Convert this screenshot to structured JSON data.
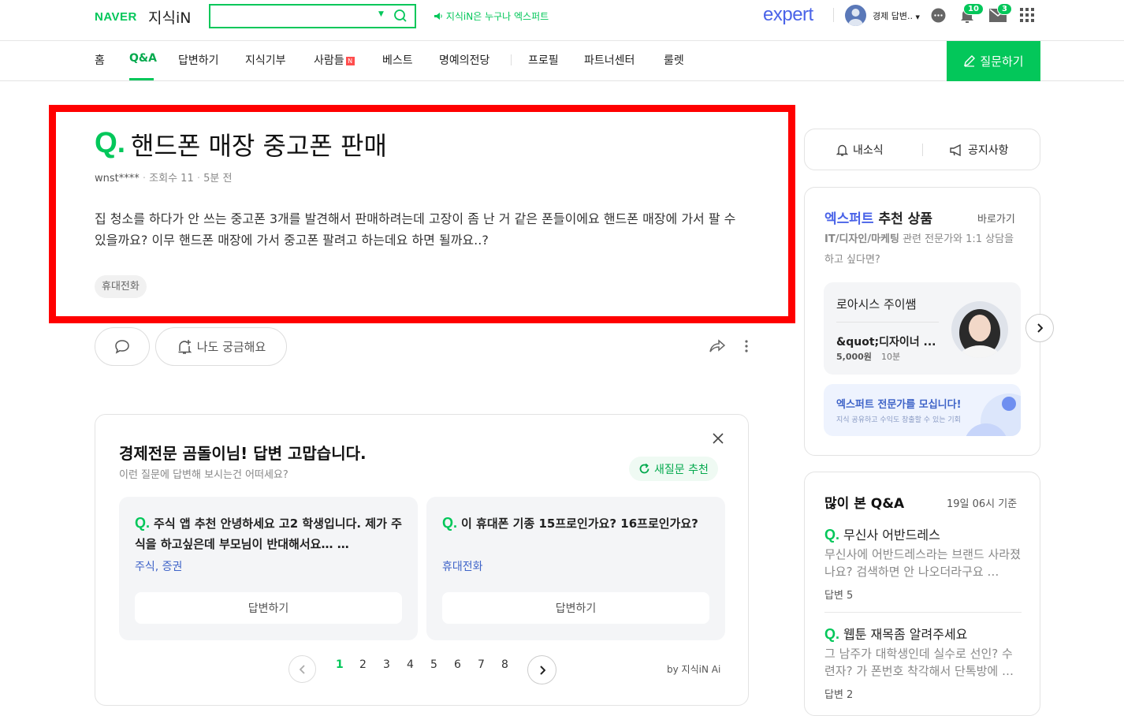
{
  "topbar": {
    "logo_naver": "NAVER",
    "logo_service": "지식iN",
    "search_placeholder": "",
    "slogan": "지식iN은 누구나 엑스퍼트",
    "expert_logo": "expert",
    "user_name": "경제 답변..",
    "notification_count": "10",
    "mail_count": "3"
  },
  "nav": {
    "items": [
      "홈",
      "Q&A",
      "답변하기",
      "지식기부",
      "사람들",
      "베스트",
      "명예의전당",
      "프로필",
      "파트너센터",
      "룰렛"
    ],
    "new_badge": "N",
    "ask_button": "질문하기"
  },
  "question": {
    "q_mark": "Q.",
    "title": "핸드폰 매장 중고폰 판매",
    "author": "wnst****",
    "views": "조회수 11",
    "time": "5분 전",
    "body": "집 청소를 하다가 안 쓰는 중고폰 3개를 발견해서 판매하려는데 고장이 좀 난 거 같은 폰들이에요 핸드폰 매장에 가서 팔 수 있을까요? 이무 핸드폰 매장에 가서 중고폰 팔려고 하는데요 하면 될까요..?",
    "tag": "휴대전화",
    "curious_button": "나도 궁금해요"
  },
  "recommend": {
    "title": "경제전문 곰돌이님! 답변 고맙습니다.",
    "subtitle": "이런 질문에 답변해 보시는건 어떠세요?",
    "refresh": "새질문 추천",
    "cards": [
      {
        "q": "Q.",
        "text": "주식 앱 추천 안녕하세요 고2 학생입니다. 제가 주식을 하고싶은데 부모님이 반대해서요… …",
        "category": "주식, 증권",
        "button": "답변하기"
      },
      {
        "q": "Q.",
        "text": "이 휴대폰 기종 15프로인가요? 16프로인가요?",
        "category": "휴대전화",
        "button": "답변하기"
      }
    ],
    "pages": [
      "1",
      "2",
      "3",
      "4",
      "5",
      "6",
      "7",
      "8"
    ],
    "by_label": "by 지식iN Ai"
  },
  "sidebar": {
    "my_news": "내소식",
    "notice": "공지사항",
    "expert_title_brand": "엑스퍼트",
    "expert_title_rest": " 추천 상품",
    "shortcut": "바로가기",
    "expert_desc_bold": "IT/디자인/마케팅",
    "expert_desc_rest": " 관련 전문가와 1:1 상담을 하고 싶다면?",
    "expert_name": "로아시스 주이쌤",
    "expert_product": "&quot;디자이너 ...",
    "expert_price": "5,000원",
    "expert_duration": "10분",
    "recruit_title": "엑스퍼트 전문가를 모십니다!",
    "recruit_sub": "지식 공유하고 수익도 창출할 수 있는 기회",
    "popular_title": "많이 본 Q&A",
    "popular_time": "19일 06시 기준",
    "popular": [
      {
        "q": "Q.",
        "title": "무신사 어반드레스",
        "desc": "무신사에 어반드레스라는 브랜드 사라졌나요? 검색하면 안 나오더라구요 …",
        "answers": "답변 5"
      },
      {
        "q": "Q.",
        "title": "웹툰 재목좀 알려주세요",
        "desc": "그 남주가 대학생인데 실수로 선인? 수련자? 가 폰번호 착각해서 단톡방에 …",
        "answers": "답변 2"
      }
    ]
  },
  "colors": {
    "brand_green": "#03c75a",
    "highlight_red": "#ff0000",
    "expert_blue": "#4a63e8"
  }
}
